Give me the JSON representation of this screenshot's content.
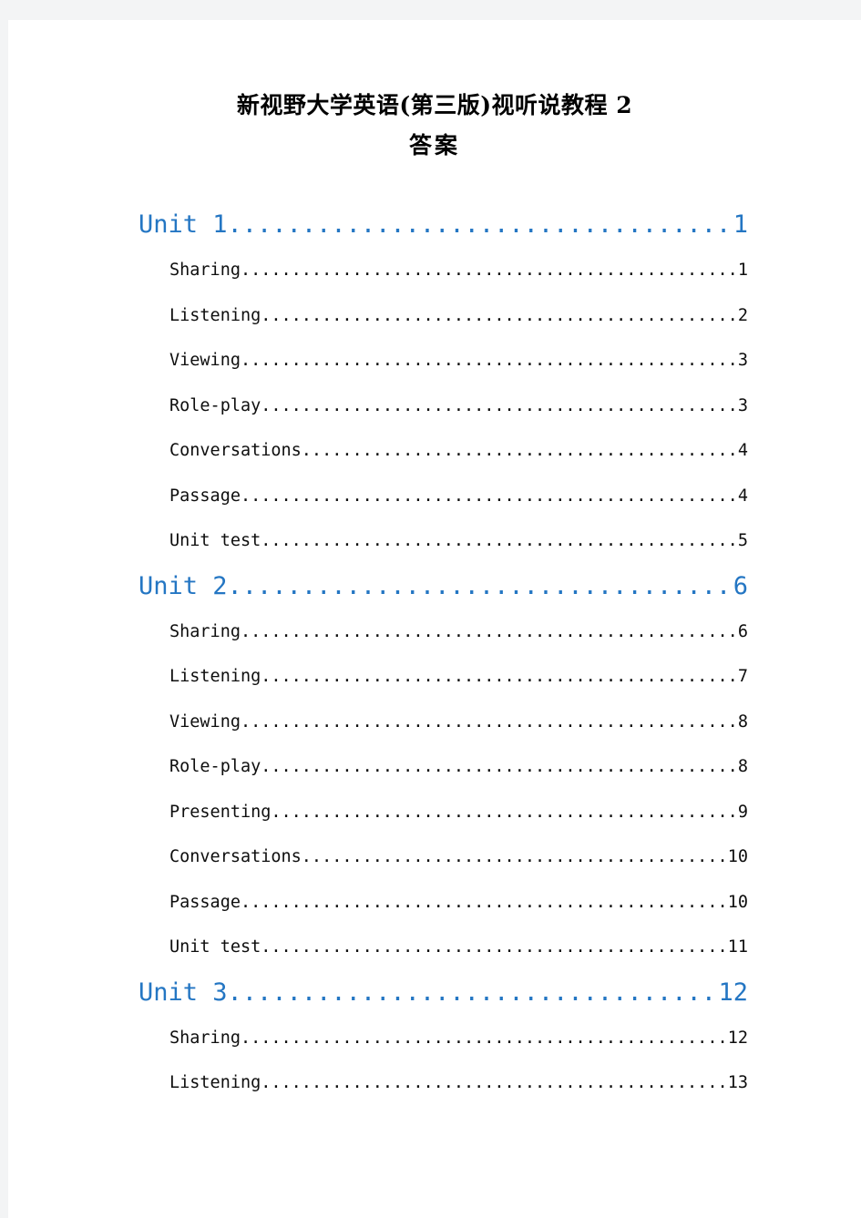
{
  "document": {
    "title_lines": [
      "新视野大学英语(第三版)视听说教程 2",
      "答案"
    ],
    "heading_color": "#2476c3",
    "body_color": "#0e0e0e",
    "page_background": "#ffffff",
    "canvas_background": "#f3f4f5"
  },
  "toc": {
    "entries": [
      {
        "label": "Unit 1",
        "page": "1",
        "level": 1
      },
      {
        "label": "Sharing",
        "page": "1",
        "level": 2
      },
      {
        "label": "Listening",
        "page": "2",
        "level": 2
      },
      {
        "label": "Viewing",
        "page": "3",
        "level": 2
      },
      {
        "label": "Role-play",
        "page": "3",
        "level": 2
      },
      {
        "label": "Conversations",
        "page": "4",
        "level": 2
      },
      {
        "label": "Passage",
        "page": "4",
        "level": 2
      },
      {
        "label": "Unit test",
        "page": "5",
        "level": 2
      },
      {
        "label": "Unit 2",
        "page": "6",
        "level": 1
      },
      {
        "label": "Sharing",
        "page": "6",
        "level": 2
      },
      {
        "label": "Listening",
        "page": "7",
        "level": 2
      },
      {
        "label": "Viewing",
        "page": "8",
        "level": 2
      },
      {
        "label": "Role-play",
        "page": "8",
        "level": 2
      },
      {
        "label": "Presenting",
        "page": "9",
        "level": 2
      },
      {
        "label": "Conversations",
        "page": "10",
        "level": 2
      },
      {
        "label": "Passage",
        "page": "10",
        "level": 2
      },
      {
        "label": "Unit test",
        "page": "11",
        "level": 2
      },
      {
        "label": "Unit 3",
        "page": "12",
        "level": 1
      },
      {
        "label": "Sharing",
        "page": "12",
        "level": 2
      },
      {
        "label": "Listening",
        "page": "13",
        "level": 2
      }
    ]
  }
}
